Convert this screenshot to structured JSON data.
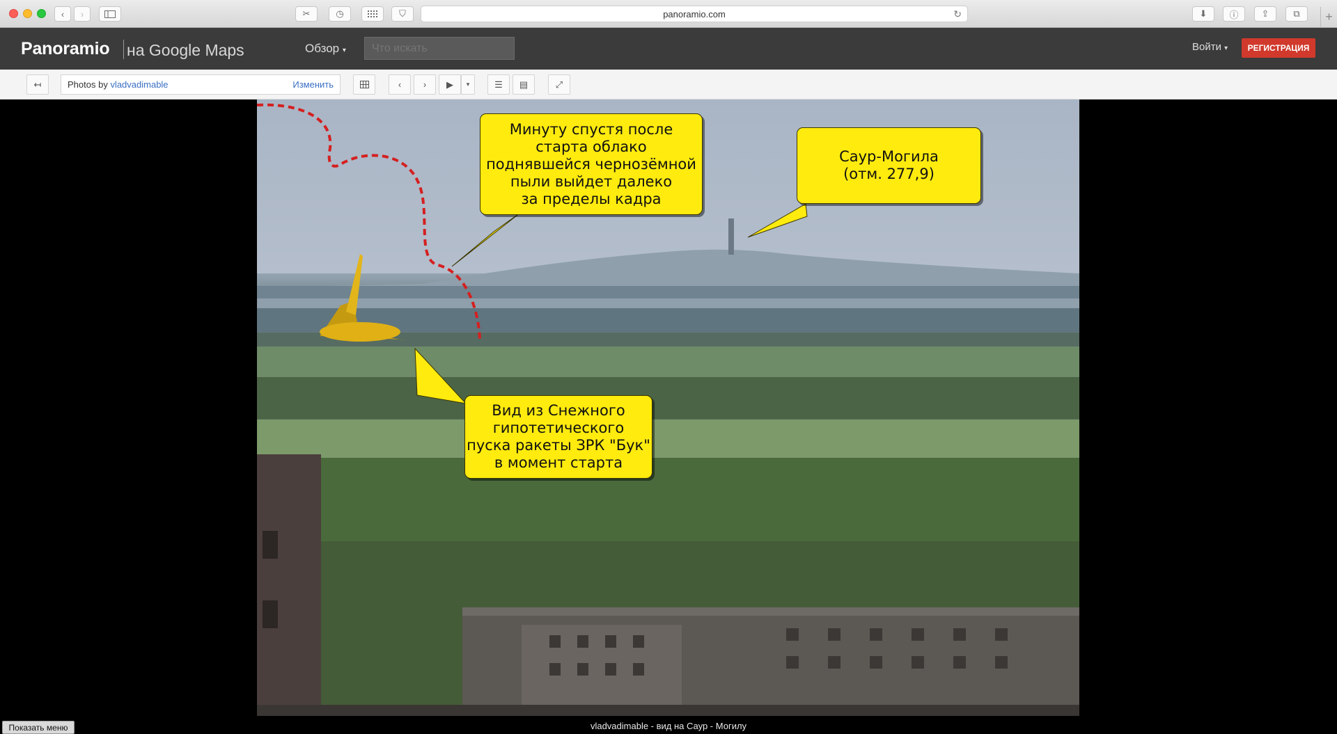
{
  "browser": {
    "url": "panoramio.com"
  },
  "header": {
    "logo_main": "Panoramio",
    "logo_sub": "на Google Maps",
    "browse_label": "Обзор",
    "search_placeholder": "Что искать",
    "login_label": "Войти",
    "register_label": "РЕГИСТРАЦИЯ"
  },
  "toolbar": {
    "photos_by_prefix": "Photos by ",
    "username": "vladvadimable",
    "change_label": "Изменить"
  },
  "photo": {
    "callouts": {
      "launch_cloud": "Минуту спустя после\nстарта облако\nподнявшейся чернозёмной\nпыли выйдет далеко\nза пределы кадра",
      "saur_mogila": "Саур-Могила\n(отм. 277,9)",
      "view_from_snezhnoe": "Вид из Снежного\nгипотетического\nпуска ракеты ЗРК \"Бук\"\nв момент старта"
    },
    "colors": {
      "callout_fill": "#ffeb0e",
      "trail": "#d42020"
    }
  },
  "footer": {
    "show_menu_label": "Показать меню",
    "caption": "vladvadimable - вид на Саур - Могилу"
  }
}
